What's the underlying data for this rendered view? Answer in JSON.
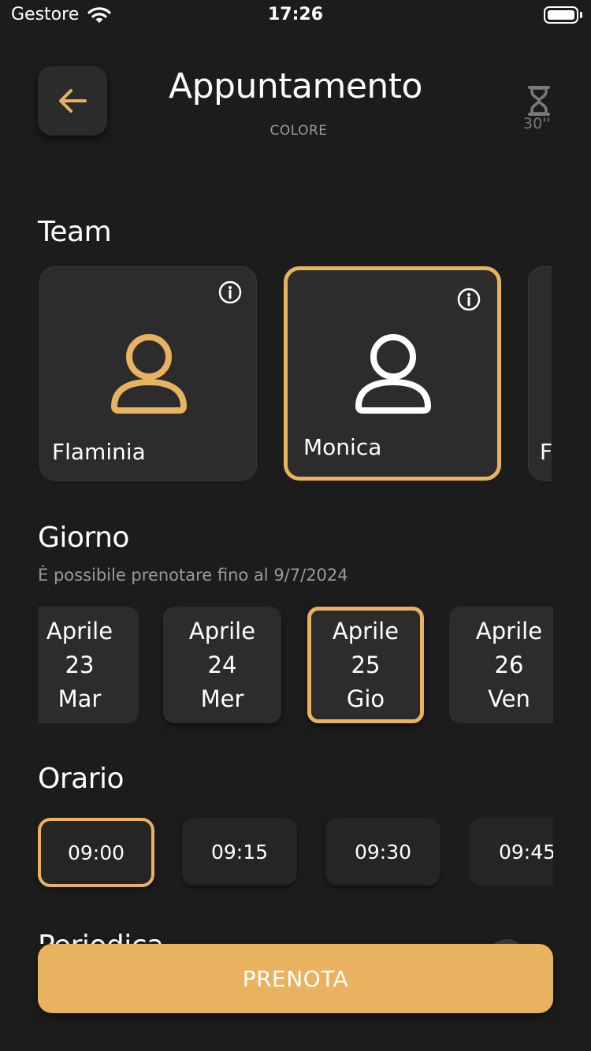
{
  "status_bar": {
    "carrier": "Gestore",
    "time": "17:26"
  },
  "header": {
    "title": "Appuntamento",
    "subtitle": "COLORE",
    "timer_label": "30''"
  },
  "team": {
    "title": "Team",
    "members": [
      {
        "name": "Flaminia",
        "selected": false
      },
      {
        "name": "Monica",
        "selected": true
      },
      {
        "name": "F",
        "selected": false
      }
    ]
  },
  "day": {
    "title": "Giorno",
    "hint": "È possibile prenotare fino al 9/7/2024",
    "days": [
      {
        "month": "Aprile",
        "date": "23",
        "weekday": "Mar",
        "selected": false
      },
      {
        "month": "Aprile",
        "date": "24",
        "weekday": "Mer",
        "selected": false
      },
      {
        "month": "Aprile",
        "date": "25",
        "weekday": "Gio",
        "selected": true
      },
      {
        "month": "Aprile",
        "date": "26",
        "weekday": "Ven",
        "selected": false
      }
    ]
  },
  "time": {
    "title": "Orario",
    "slots": [
      {
        "label": "09:00",
        "selected": true
      },
      {
        "label": "09:15",
        "selected": false
      },
      {
        "label": "09:30",
        "selected": false
      },
      {
        "label": "09:45",
        "selected": false
      }
    ]
  },
  "periodic": {
    "title": "Periodica"
  },
  "book_button": {
    "label": "PRENOTA"
  },
  "colors": {
    "background": "#1c1c1c",
    "card": "#2c2c2c",
    "accent": "#e8b261",
    "muted_text": "#9a9a9a"
  },
  "icons": {
    "back": "arrow-left-icon",
    "timer": "hourglass-icon",
    "info": "info-icon",
    "person": "person-icon",
    "wifi": "wifi-icon",
    "battery": "battery-icon"
  }
}
